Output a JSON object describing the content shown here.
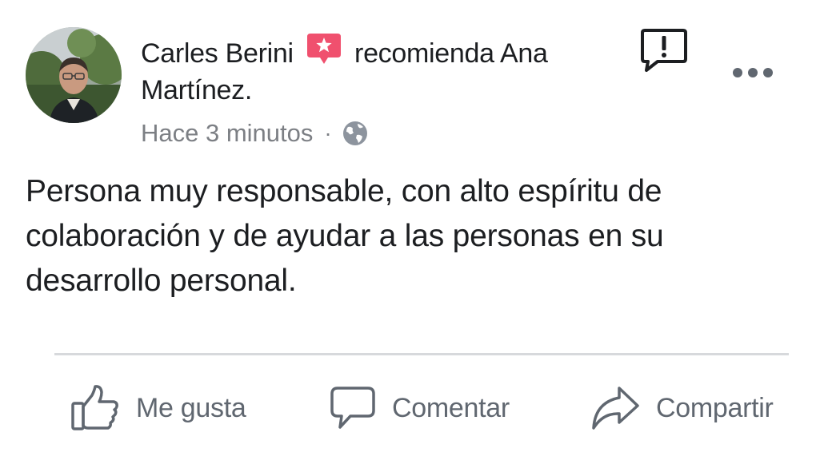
{
  "post": {
    "author": "Carles Berini",
    "verb": "recomienda",
    "target": "Ana Martínez.",
    "time": "Hace 3 minutos",
    "separator": "·",
    "privacy_icon": "globe-icon",
    "text": "Persona muy responsable, con alto espíritu de colaboración y de ayudar a las personas en su desarrollo personal."
  },
  "actions": {
    "like_label": "Me gusta",
    "comment_label": "Comentar",
    "share_label": "Compartir"
  },
  "icons": [
    "recommendation-star-icon",
    "report-icon",
    "more-options-icon",
    "thumbs-up-icon",
    "comment-bubble-icon",
    "share-arrow-icon"
  ],
  "colors": {
    "recommendation_badge": "#f0506e",
    "text_primary": "#1c1e21",
    "text_secondary": "#7c7f84",
    "action_gray": "#606770",
    "divider": "#d7d9dc"
  }
}
